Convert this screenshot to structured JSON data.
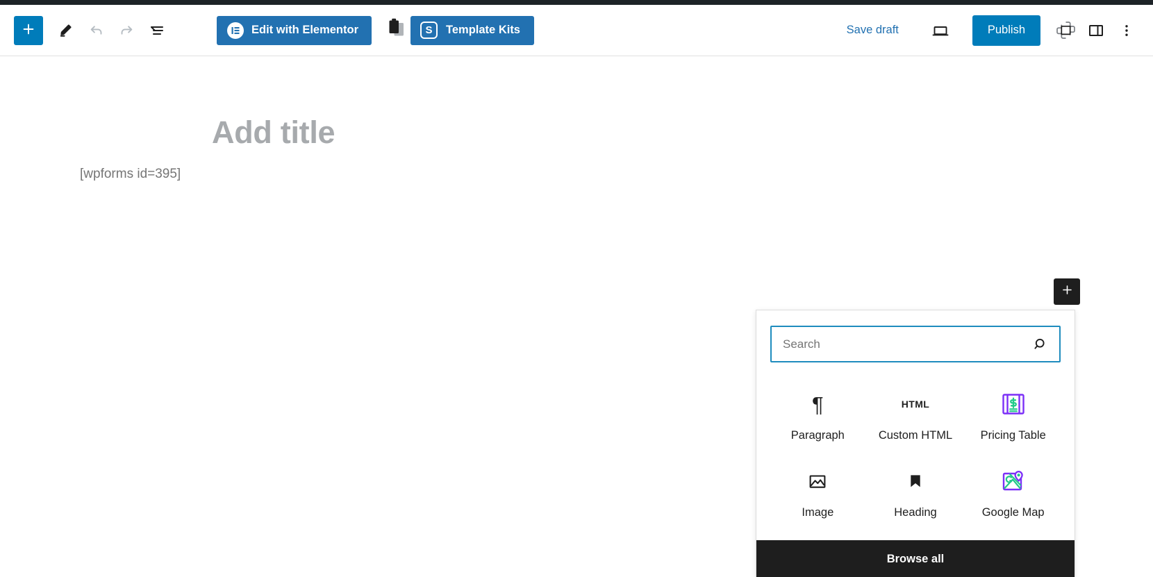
{
  "window": {
    "admin_bar_color": "#1d2327"
  },
  "header": {
    "left_tools": [
      {
        "name": "block-inserter-toggle",
        "icon": "plus-icon",
        "label": "Toggle block inserter"
      },
      {
        "name": "tools-pencil",
        "icon": "pencil-icon",
        "label": "Tools"
      },
      {
        "name": "undo",
        "icon": "undo-icon",
        "label": "Undo"
      },
      {
        "name": "redo",
        "icon": "redo-icon",
        "label": "Redo"
      },
      {
        "name": "list-view",
        "icon": "list-view-icon",
        "label": "Details"
      }
    ],
    "elementor_button": {
      "label": "Edit with Elementor",
      "icon": "elementor-logo-icon",
      "badge_letter": "E",
      "bg_color": "#2271b1"
    },
    "copy_icon": "clipboard-copy-icon",
    "template_kits_button": {
      "label": "Template Kits",
      "icon": "envato-s-icon",
      "badge_letter": "S",
      "bg_color": "#2271b1"
    },
    "save_draft_label": "Save draft",
    "preview_icon": "desktop-preview-icon",
    "publish_button": {
      "label": "Publish",
      "bg_color": "#007cba"
    },
    "jetpack_icon": "jetpack-plugin-icon",
    "settings_sidebar_icon": "sidebar-toggle-icon",
    "options_icon": "more-vertical-icon"
  },
  "editor": {
    "title_placeholder": "Add title",
    "blocks": [
      {
        "type": "shortcode",
        "content": "[wpforms id=395]"
      }
    ],
    "appender_icon": "plus-icon"
  },
  "quick_inserter": {
    "search": {
      "value": "",
      "placeholder": "Search",
      "icon": "search-icon"
    },
    "blocks": [
      {
        "label": "Paragraph",
        "icon": "pilcrow-icon",
        "style": "glyph"
      },
      {
        "label": "Custom HTML",
        "icon": "html-icon",
        "style": "glyph"
      },
      {
        "label": "Pricing Table",
        "icon": "pricing-table-icon",
        "style": "color"
      },
      {
        "label": "Image",
        "icon": "image-icon",
        "style": "glyph"
      },
      {
        "label": "Heading",
        "icon": "heading-bookmark-icon",
        "style": "glyph"
      },
      {
        "label": "Google Map",
        "icon": "google-map-icon",
        "style": "color"
      }
    ],
    "browse_all_label": "Browse all",
    "accent_color": "#1e8cbe",
    "footer_color": "#1e1e1e",
    "icon_purple": "#7b2ff7",
    "icon_green": "#22c98a"
  }
}
